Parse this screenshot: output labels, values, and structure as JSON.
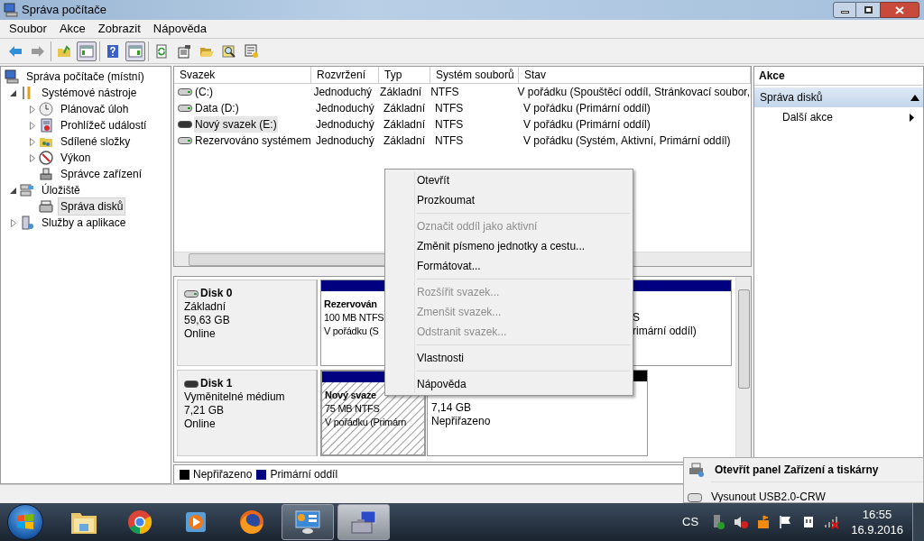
{
  "window": {
    "title": "Správa počítače"
  },
  "menu": [
    "Soubor",
    "Akce",
    "Zobrazit",
    "Nápověda"
  ],
  "toolbar": [
    [
      {
        "kind": "back",
        "disabled": false
      },
      {
        "kind": "forward",
        "disabled": true
      }
    ],
    [
      {
        "kind": "up"
      },
      {
        "kind": "tree-toggle",
        "pressed": true
      }
    ],
    [
      {
        "kind": "help"
      },
      {
        "kind": "action-toggle",
        "pressed": true
      }
    ],
    [
      {
        "kind": "refresh"
      },
      {
        "kind": "properties"
      },
      {
        "kind": "open"
      },
      {
        "kind": "search"
      },
      {
        "kind": "settings"
      }
    ]
  ],
  "tree": [
    {
      "label": "Správa počítače (místní)",
      "kind": "computer",
      "selected": false,
      "children": [
        {
          "label": "Systémové nástroje",
          "kind": "tools",
          "expanded": true,
          "selected": false,
          "children": [
            {
              "label": "Plánovač úloh",
              "kind": "clock",
              "expanded": false,
              "selected": false
            },
            {
              "label": "Prohlížeč událostí",
              "kind": "log",
              "expanded": false,
              "selected": false
            },
            {
              "label": "Sdílené složky",
              "kind": "share",
              "expanded": false,
              "selected": false
            },
            {
              "label": "Výkon",
              "kind": "performance",
              "expanded": false,
              "selected": false
            },
            {
              "label": "Správce zařízení",
              "kind": "devices",
              "selected": false
            }
          ]
        },
        {
          "label": "Úložiště",
          "kind": "storage",
          "expanded": true,
          "selected": false,
          "children": [
            {
              "label": "Správa disků",
              "kind": "disk",
              "selected": true
            }
          ]
        },
        {
          "label": "Služby a aplikace",
          "kind": "services",
          "expanded": false,
          "selected": false
        }
      ]
    }
  ],
  "volumes": {
    "columns": [
      "Svazek",
      "Rozvržení",
      "Typ",
      "Systém souborů",
      "Stav"
    ],
    "rows": [
      {
        "cells": [
          "(C:)",
          "Jednoduchý",
          "Základní",
          "NTFS",
          "V pořádku (Spouštěcí oddíl, Stránkovací soubor,"
        ],
        "removable": false,
        "selected": false
      },
      {
        "cells": [
          "Data (D:)",
          "Jednoduchý",
          "Základní",
          "NTFS",
          "V pořádku (Primární oddíl)"
        ],
        "removable": false,
        "selected": false
      },
      {
        "cells": [
          "Nový svazek (E:)",
          "Jednoduchý",
          "Základní",
          "NTFS",
          "V pořádku (Primární oddíl)"
        ],
        "removable": true,
        "selected": true
      },
      {
        "cells": [
          "Rezervováno systémem",
          "Jednoduchý",
          "Základní",
          "NTFS",
          "V pořádku (Systém, Aktivní, Primární oddíl)"
        ],
        "removable": false,
        "selected": false
      }
    ]
  },
  "disks": [
    {
      "name": "Disk 0",
      "type": "Základní",
      "size": "59,63 GB",
      "status": "Online",
      "removable": false,
      "partitions": [
        {
          "kind": "primary",
          "selected": false,
          "name": "Rezervován",
          "detail": "100 MB NTFS",
          "status": "V pořádku (S"
        },
        {
          "kind": "primary",
          "selected": false,
          "detail": "S",
          "status": "rimární oddíl)"
        }
      ]
    },
    {
      "name": "Disk 1",
      "type": "Vyměnitelné médium",
      "size": "7,21 GB",
      "status": "Online",
      "removable": true,
      "partitions": [
        {
          "kind": "primary",
          "selected": true,
          "name": "Nový svaze",
          "detail": "75 MB NTFS",
          "status": "V pořádku (Primárn"
        },
        {
          "kind": "unallocated",
          "selected": false,
          "detail": "7,14 GB",
          "status": "Nepřiřazeno"
        }
      ]
    }
  ],
  "legend": [
    {
      "label": "Nepřiřazeno",
      "color": "#000000"
    },
    {
      "label": "Primární oddíl",
      "color": "#000080"
    }
  ],
  "actions": {
    "title": "Akce",
    "items": [
      {
        "label": "Správa disků",
        "kind": "section"
      },
      {
        "label": "Další akce",
        "kind": "item"
      }
    ]
  },
  "context_menu": [
    [
      {
        "label": "Otevřít",
        "disabled": false
      },
      {
        "label": "Prozkoumat",
        "disabled": false
      }
    ],
    [
      {
        "label": "Označit oddíl jako aktivní",
        "disabled": true
      },
      {
        "label": "Změnit písmeno jednotky a cestu...",
        "disabled": false
      },
      {
        "label": "Formátovat...",
        "disabled": false
      }
    ],
    [
      {
        "label": "Rozšířit svazek...",
        "disabled": true
      },
      {
        "label": "Zmenšit svazek...",
        "disabled": true
      },
      {
        "label": "Odstranit svazek...",
        "disabled": true
      }
    ],
    [
      {
        "label": "Vlastnosti",
        "disabled": false
      }
    ],
    [
      {
        "label": "Nápověda",
        "disabled": false
      }
    ]
  ],
  "tray_popup": [
    {
      "label": "Otevřít panel Zařízení a tiskárny",
      "kind": "devices"
    },
    {
      "label": "Vysunout USB2.0-CRW",
      "kind": "eject"
    }
  ],
  "taskbar": {
    "apps": [
      {
        "kind": "folder",
        "active": false,
        "selected": false
      },
      {
        "kind": "chrome",
        "active": false,
        "selected": false
      },
      {
        "kind": "media",
        "active": false,
        "selected": false
      },
      {
        "kind": "firefox",
        "active": false,
        "selected": false
      },
      {
        "kind": "control-panel",
        "active": true,
        "selected": false
      },
      {
        "kind": "management",
        "active": true,
        "selected": true
      }
    ],
    "language": "CS",
    "time": "16:55",
    "date": "16.9.2016"
  }
}
